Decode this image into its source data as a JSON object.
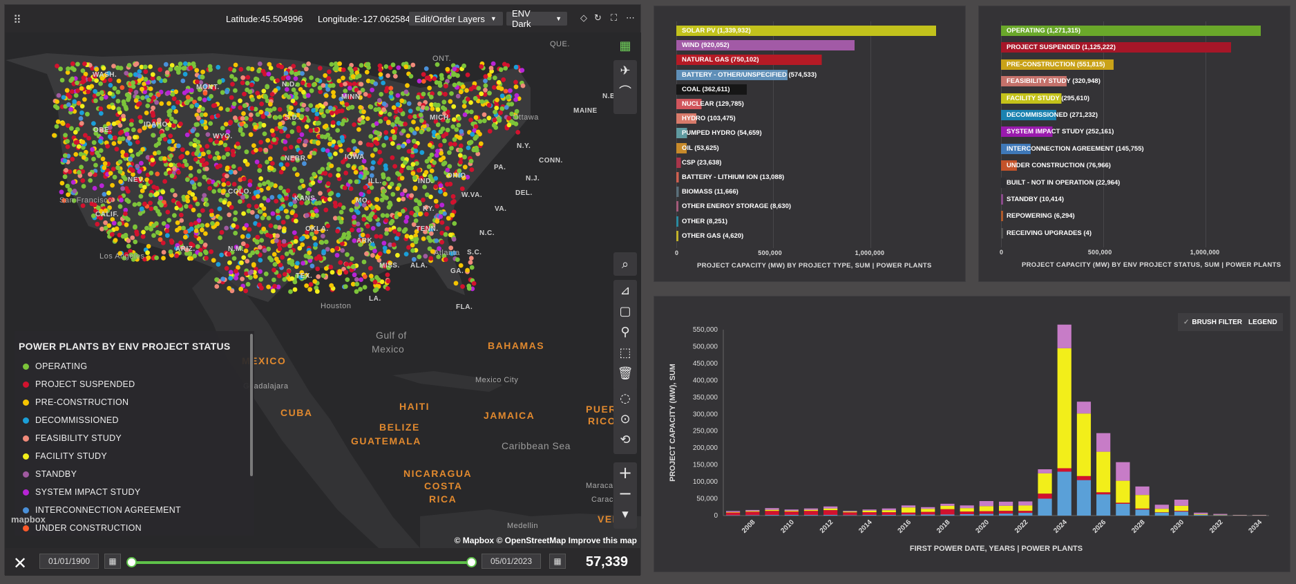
{
  "toolbar": {
    "latitude": "Latitude:45.504996",
    "longitude": "Longitude:-127.062584",
    "layers_dropdown": "Edit/Order Layers",
    "basemap_dropdown": "ENV Dark"
  },
  "map_labels": [
    {
      "t": "ONT.",
      "c": "g"
    },
    {
      "t": "QUE.",
      "c": "g"
    },
    {
      "t": "WASH."
    },
    {
      "t": "MONT."
    },
    {
      "t": "N.D."
    },
    {
      "t": "MINN."
    },
    {
      "t": "MAINE"
    },
    {
      "t": "N.B."
    },
    {
      "t": "IDAHO"
    },
    {
      "t": "ORE."
    },
    {
      "t": "WYO."
    },
    {
      "t": "S.D."
    },
    {
      "t": "MICH."
    },
    {
      "t": "Ottawa",
      "c": "g"
    },
    {
      "t": "N.Y."
    },
    {
      "t": "NEBR."
    },
    {
      "t": "IOWA"
    },
    {
      "t": "CONN."
    },
    {
      "t": "NEV."
    },
    {
      "t": "ILL."
    },
    {
      "t": "IND."
    },
    {
      "t": "OHIO"
    },
    {
      "t": "PA."
    },
    {
      "t": "N.J."
    },
    {
      "t": "San Francisco",
      "c": "g"
    },
    {
      "t": "COLO."
    },
    {
      "t": "KANS."
    },
    {
      "t": "MO."
    },
    {
      "t": "W.VA."
    },
    {
      "t": "DEL."
    },
    {
      "t": "CALIF."
    },
    {
      "t": "KY."
    },
    {
      "t": "VA."
    },
    {
      "t": "OKLA."
    },
    {
      "t": "TENN."
    },
    {
      "t": "N.C."
    },
    {
      "t": "ARIZ."
    },
    {
      "t": "N.M."
    },
    {
      "t": "ARK."
    },
    {
      "t": "S.C."
    },
    {
      "t": "Los Angeles",
      "c": "g"
    },
    {
      "t": "Atlanta",
      "c": "g"
    },
    {
      "t": "TEX."
    },
    {
      "t": "MISS."
    },
    {
      "t": "ALA."
    },
    {
      "t": "GA."
    },
    {
      "t": "LA."
    },
    {
      "t": "Houston",
      "c": "g"
    },
    {
      "t": "FLA."
    },
    {
      "t": "Gulf of",
      "c": "og"
    },
    {
      "t": "Mexico",
      "c": "og"
    },
    {
      "t": "MEXICO",
      "c": "o"
    },
    {
      "t": "BAHAMAS",
      "c": "o"
    },
    {
      "t": "Guadalajara",
      "c": "g"
    },
    {
      "t": "CUBA",
      "c": "o"
    },
    {
      "t": "Mexico City",
      "c": "g"
    },
    {
      "t": "HAITI",
      "c": "o"
    },
    {
      "t": "PUERTO",
      "c": "o"
    },
    {
      "t": "RICO",
      "c": "o"
    },
    {
      "t": "BELIZE",
      "c": "o"
    },
    {
      "t": "JAMAICA",
      "c": "o"
    },
    {
      "t": "GUATEMALA",
      "c": "o"
    },
    {
      "t": "Caribbean Sea",
      "c": "og"
    },
    {
      "t": "NICARAGUA",
      "c": "o"
    },
    {
      "t": "COSTA",
      "c": "o"
    },
    {
      "t": "RICA",
      "c": "o"
    },
    {
      "t": "Maracaibo",
      "c": "g"
    },
    {
      "t": "Caracas",
      "c": "g"
    },
    {
      "t": "Medellin",
      "c": "g"
    },
    {
      "t": "VENE",
      "c": "o"
    }
  ],
  "legend": {
    "title": "POWER PLANTS BY ENV PROJECT STATUS",
    "items": [
      {
        "label": "OPERATING",
        "color": "#7cc43a"
      },
      {
        "label": "PROJECT SUSPENDED",
        "color": "#d2122e"
      },
      {
        "label": "PRE-CONSTRUCTION",
        "color": "#f5c400"
      },
      {
        "label": "DECOMMISSIONED",
        "color": "#1b9fd8"
      },
      {
        "label": "FEASIBILITY STUDY",
        "color": "#f08a7a"
      },
      {
        "label": "FACILITY STUDY",
        "color": "#f2ee1a"
      },
      {
        "label": "STANDBY",
        "color": "#a05aa0"
      },
      {
        "label": "SYSTEM IMPACT STUDY",
        "color": "#b824d6"
      },
      {
        "label": "INTERCONNECTION AGREEMENT",
        "color": "#4a90d9"
      },
      {
        "label": "UNDER CONSTRUCTION",
        "color": "#ff5a2a"
      }
    ]
  },
  "map_footer": {
    "attribution": "© Mapbox © OpenStreetMap",
    "improve": "Improve this map",
    "mapbox_logo": "mapbox"
  },
  "timeline": {
    "start_date": "01/01/1900",
    "end_date": "05/01/2023",
    "count": "57,339"
  },
  "chart_data": [
    {
      "type": "bar",
      "orientation": "horizontal",
      "title": "PROJECT CAPACITY (MW) BY PROJECT TYPE, SUM | POWER PLANTS",
      "ticks": [
        "0",
        "500,000",
        "1,000,000"
      ],
      "xlim": [
        0,
        1339932
      ],
      "bars": [
        {
          "label": "SOLAR PV (1,339,932)",
          "value": 1339932,
          "color": "#c2c21c"
        },
        {
          "label": "WIND (920,052)",
          "value": 920052,
          "color": "#a25aa6"
        },
        {
          "label": "NATURAL GAS (750,102)",
          "value": 750102,
          "color": "#b51a25"
        },
        {
          "label": "BATTERY - OTHER/UNSPECIFIED (574,533)",
          "value": 574533,
          "color": "#5f8fb8"
        },
        {
          "label": "COAL (362,611)",
          "value": 362611,
          "color": "#161616"
        },
        {
          "label": "NUCLEAR (129,785)",
          "value": 129785,
          "color": "#d1555c"
        },
        {
          "label": "HYDRO (103,475)",
          "value": 103475,
          "color": "#d87a6a"
        },
        {
          "label": "PUMPED HYDRO (54,659)",
          "value": 54659,
          "color": "#5f9aa0"
        },
        {
          "label": "OIL (53,625)",
          "value": 53625,
          "color": "#c78a2a"
        },
        {
          "label": "CSP (23,638)",
          "value": 23638,
          "color": "#a8354a"
        },
        {
          "label": "BATTERY - LITHIUM ION (13,088)",
          "value": 13088,
          "color": "#d06050"
        },
        {
          "label": "BIOMASS (11,666)",
          "value": 11666,
          "color": "#5a6f7a"
        },
        {
          "label": "OTHER ENERGY STORAGE (8,630)",
          "value": 8630,
          "color": "#a35a7a"
        },
        {
          "label": "OTHER (8,251)",
          "value": 8251,
          "color": "#2a8aa0"
        },
        {
          "label": "OTHER GAS (4,620)",
          "value": 4620,
          "color": "#c2b22a"
        }
      ]
    },
    {
      "type": "bar",
      "orientation": "horizontal",
      "title": "PROJECT CAPACITY (MW) BY ENV PROJECT STATUS, SUM | POWER PLANTS",
      "ticks": [
        "0",
        "500,000",
        "1,000,000"
      ],
      "xlim": [
        0,
        1271315
      ],
      "bars": [
        {
          "label": "OPERATING (1,271,315)",
          "value": 1271315,
          "color": "#6aa82a"
        },
        {
          "label": "PROJECT SUSPENDED (1,125,222)",
          "value": 1125222,
          "color": "#a61628"
        },
        {
          "label": "PRE-CONSTRUCTION (551,815)",
          "value": 551815,
          "color": "#c9a218"
        },
        {
          "label": "FEASIBILITY STUDY (320,948)",
          "value": 320948,
          "color": "#c4716a"
        },
        {
          "label": "FACILITY STUDY (295,610)",
          "value": 295610,
          "color": "#c4c21a"
        },
        {
          "label": "DECOMMISSIONED (271,232)",
          "value": 271232,
          "color": "#1a82b0"
        },
        {
          "label": "SYSTEM IMPACT STUDY (252,161)",
          "value": 252161,
          "color": "#9a1aae"
        },
        {
          "label": "INTERCONNECTION AGREEMENT (145,755)",
          "value": 145755,
          "color": "#3f78b8"
        },
        {
          "label": "UNDER CONSTRUCTION (76,966)",
          "value": 76966,
          "color": "#c4532a"
        },
        {
          "label": "BUILT - NOT IN OPERATION (22,964)",
          "value": 22964,
          "color": "#2f2f33"
        },
        {
          "label": "STANDBY (10,414)",
          "value": 10414,
          "color": "#8a4a8a"
        },
        {
          "label": "REPOWERING (6,294)",
          "value": 6294,
          "color": "#b05a2a"
        },
        {
          "label": "RECEIVING UPGRADES (4)",
          "value": 4,
          "color": "#555"
        }
      ]
    },
    {
      "type": "bar",
      "stacked": true,
      "xlabel": "FIRST POWER DATE, YEARS | POWER PLANTS",
      "ylabel": "PROJECT CAPACITY (MW), SUM",
      "ylim": [
        0,
        550000
      ],
      "yticks": [
        "0",
        "50,000",
        "100,000",
        "150,000",
        "200,000",
        "250,000",
        "300,000",
        "350,000",
        "400,000",
        "450,000",
        "500,000",
        "550,000"
      ],
      "xticks": [
        "2008",
        "2010",
        "2012",
        "2014",
        "2016",
        "2018",
        "2020",
        "2022",
        "2024",
        "2026",
        "2028",
        "2030",
        "2032",
        "2034"
      ],
      "categories": [
        "2007",
        "2008",
        "2009",
        "2010",
        "2011",
        "2012",
        "2013",
        "2014",
        "2015",
        "2016",
        "2017",
        "2018",
        "2019",
        "2020",
        "2021",
        "2022",
        "2023",
        "2024",
        "2025",
        "2026",
        "2027",
        "2028",
        "2029",
        "2030",
        "2031",
        "2032",
        "2033",
        "2034"
      ],
      "series": [
        {
          "color": "#5aa0d8",
          "values": [
            1000,
            1500,
            2000,
            2000,
            2000,
            2000,
            1500,
            2000,
            2000,
            3000,
            3000,
            3000,
            4000,
            5000,
            6000,
            8000,
            50000,
            130000,
            105000,
            63000,
            35000,
            18000,
            9000,
            12000,
            2000,
            1000,
            500,
            500
          ]
        },
        {
          "color": "#d2122e",
          "values": [
            8000,
            10000,
            12000,
            10000,
            12000,
            14000,
            8000,
            8000,
            8000,
            6000,
            8000,
            16000,
            8000,
            8000,
            8000,
            6000,
            15000,
            10000,
            12000,
            6000,
            3000,
            3000,
            1000,
            2000,
            500,
            500,
            0,
            0
          ]
        },
        {
          "color": "#f2ee1a",
          "values": [
            1500,
            2000,
            3000,
            2500,
            3000,
            5000,
            2500,
            5000,
            6000,
            15000,
            9000,
            10000,
            10000,
            15000,
            15000,
            16000,
            60000,
            355000,
            185000,
            120000,
            65000,
            40000,
            10000,
            15000,
            2000,
            1000,
            500,
            500
          ]
        },
        {
          "color": "#c77cc7",
          "values": [
            3000,
            3000,
            5000,
            3500,
            4000,
            6000,
            2000,
            3000,
            5000,
            6000,
            5000,
            6000,
            8000,
            15000,
            12000,
            12000,
            12000,
            70000,
            35000,
            55000,
            55000,
            25000,
            12000,
            18000,
            4000,
            2500,
            1000,
            1000
          ]
        }
      ]
    }
  ],
  "chart3_buttons": {
    "brush": "BRUSH FILTER",
    "legend": "LEGEND"
  }
}
